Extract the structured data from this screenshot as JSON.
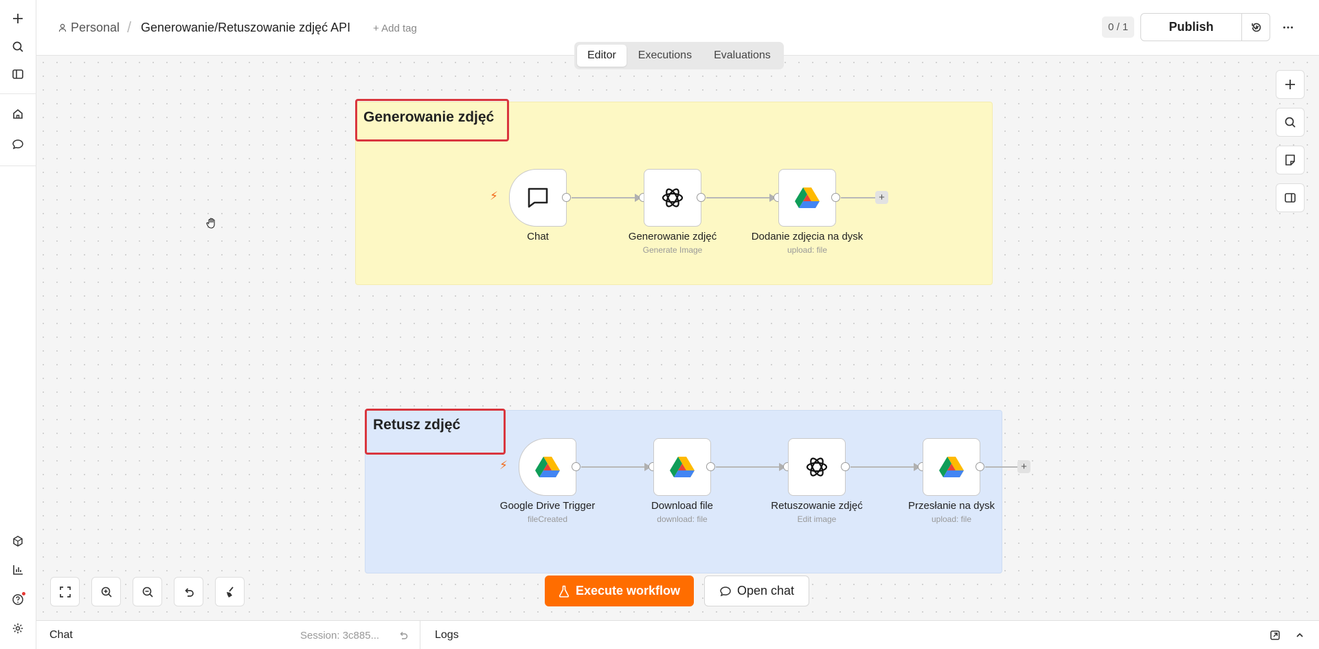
{
  "header": {
    "project": "Personal",
    "separator": "/",
    "workflow_title": "Generowanie/Retuszowanie zdjęć API",
    "add_tag": "+ Add tag",
    "counter": "0 / 1",
    "publish_label": "Publish"
  },
  "tabs": [
    {
      "label": "Editor",
      "active": true
    },
    {
      "label": "Executions",
      "active": false
    },
    {
      "label": "Evaluations",
      "active": false
    }
  ],
  "stickies": [
    {
      "title": "Generowanie zdjęć",
      "color": "#fdf8c4"
    },
    {
      "title": "Retusz zdjęć",
      "color": "#dce8fb"
    }
  ],
  "nodes": {
    "chat": {
      "label": "Chat",
      "sub": "",
      "icon": "chat-icon"
    },
    "generate": {
      "label": "Generowanie zdjęć",
      "sub": "Generate Image",
      "icon": "openai-icon"
    },
    "upload1": {
      "label": "Dodanie zdjęcia na dysk",
      "sub": "upload: file",
      "icon": "google-drive-icon"
    },
    "gdrive_trigger": {
      "label": "Google Drive Trigger",
      "sub": "fileCreated",
      "icon": "google-drive-icon"
    },
    "download": {
      "label": "Download file",
      "sub": "download: file",
      "icon": "google-drive-icon"
    },
    "retouch": {
      "label": "Retuszowanie zdjęć",
      "sub": "Edit image",
      "icon": "openai-icon"
    },
    "upload2": {
      "label": "Przesłanie na dysk",
      "sub": "upload: file",
      "icon": "google-drive-icon"
    }
  },
  "actions": {
    "execute": "Execute workflow",
    "open_chat": "Open chat"
  },
  "bottom_bar": {
    "chat": "Chat",
    "session": "Session: 3c885...",
    "logs": "Logs"
  },
  "colors": {
    "accent": "#ff6d00",
    "sticky_border": "#d9363e"
  }
}
